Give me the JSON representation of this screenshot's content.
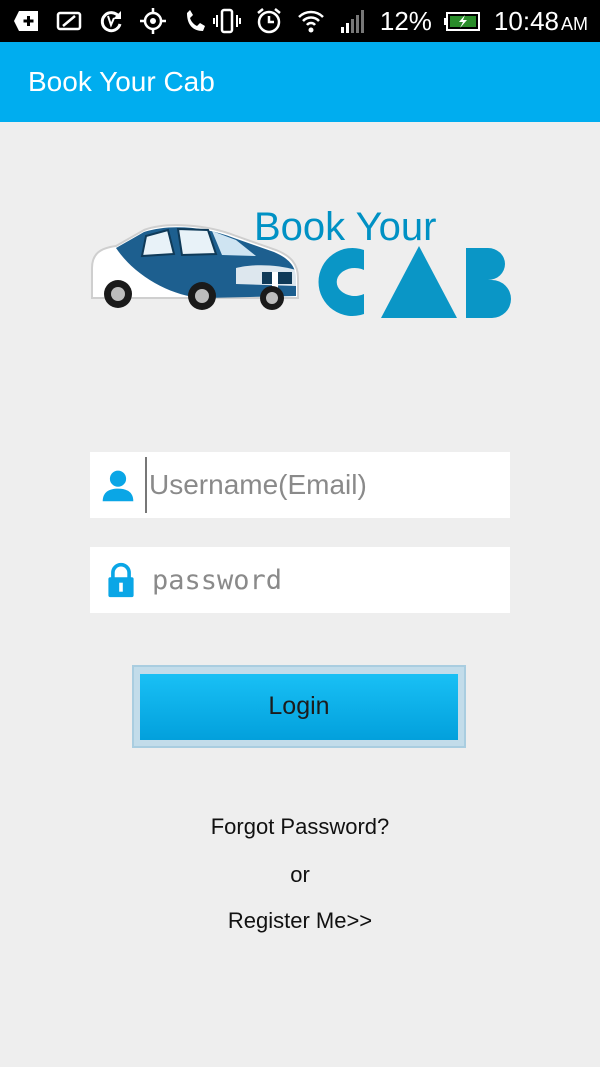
{
  "status_bar": {
    "icons": [
      "add-box-icon",
      "leaf-icon",
      "sync-icon",
      "gps-icon",
      "phone-icon",
      "vibrate-icon",
      "alarm-icon",
      "wifi-icon",
      "signal-icon"
    ],
    "battery_percent": "12%",
    "time": "10:48",
    "ampm": "AM"
  },
  "app_bar": {
    "title": "Book Your Cab"
  },
  "logo": {
    "line1": "Book Your",
    "line2": "CAB"
  },
  "form": {
    "username_placeholder": "Username(Email)",
    "password_placeholder": "password",
    "login_label": "Login"
  },
  "links": {
    "forgot": "Forgot Password?",
    "or": "or",
    "register": "Register Me>>"
  },
  "colors": {
    "accent": "#00adef",
    "logo_blue": "#0091c4",
    "car_blue": "#1d5f8f"
  }
}
